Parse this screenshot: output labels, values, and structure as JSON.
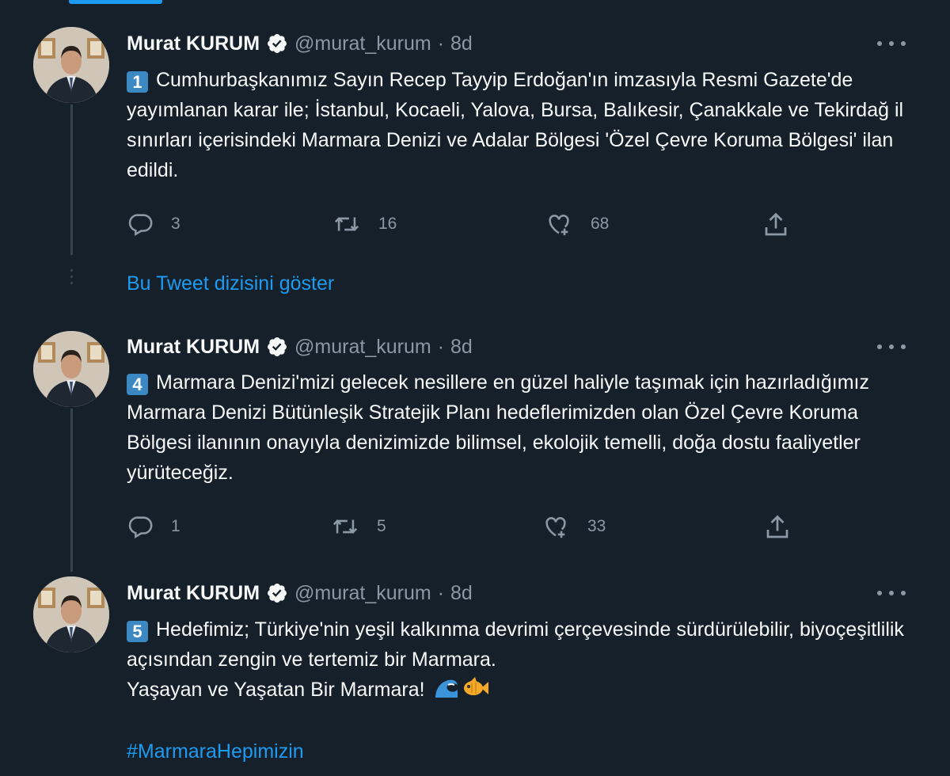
{
  "colors": {
    "background": "#15202b",
    "accent": "#1d9bf0",
    "muted": "#8b98a5",
    "keycap": "#3b88c3"
  },
  "show_thread_label": "Bu Tweet dizisini göster",
  "tweets": [
    {
      "name": "Murat KURUM",
      "handle": "@murat_kurum",
      "separator": "·",
      "time": "8d",
      "keycap": "1",
      "text": "Cumhurbaşkanımız Sayın Recep Tayyip Erdoğan'ın imzasıyla Resmi Gazete'de yayımlanan karar ile; İstanbul, Kocaeli, Yalova, Bursa, Balıkesir, Çanakkale ve Tekirdağ il sınırları içerisindeki Marmara Denizi ve Adalar Bölgesi 'Özel Çevre Koruma Bölgesi' ilan edildi.",
      "replies": "3",
      "retweets": "16",
      "likes": "68"
    },
    {
      "name": "Murat KURUM",
      "handle": "@murat_kurum",
      "separator": "·",
      "time": "8d",
      "keycap": "4",
      "text": "Marmara Denizi'mizi gelecek nesillere en güzel haliyle taşımak için hazırladığımız Marmara Denizi Bütünleşik Stratejik Planı hedeflerimizden olan Özel Çevre Koruma Bölgesi ilanının onayıyla denizimizde bilimsel, ekolojik temelli, doğa dostu faaliyetler yürüteceğiz.",
      "replies": "1",
      "retweets": "5",
      "likes": "33"
    },
    {
      "name": "Murat KURUM",
      "handle": "@murat_kurum",
      "separator": "·",
      "time": "8d",
      "keycap": "5",
      "text_line1": "Hedefimiz; Türkiye'nin yeşil kalkınma devrimi çerçevesinde sürdürülebilir, biyoçeşitlilik açısından zengin ve tertemiz bir Marmara.",
      "text_line2": "Yaşayan ve Yaşatan Bir Marmara!",
      "emojis": [
        "wave-emoji",
        "fish-emoji"
      ],
      "hashtag": "#MarmaraHepimizin"
    }
  ]
}
